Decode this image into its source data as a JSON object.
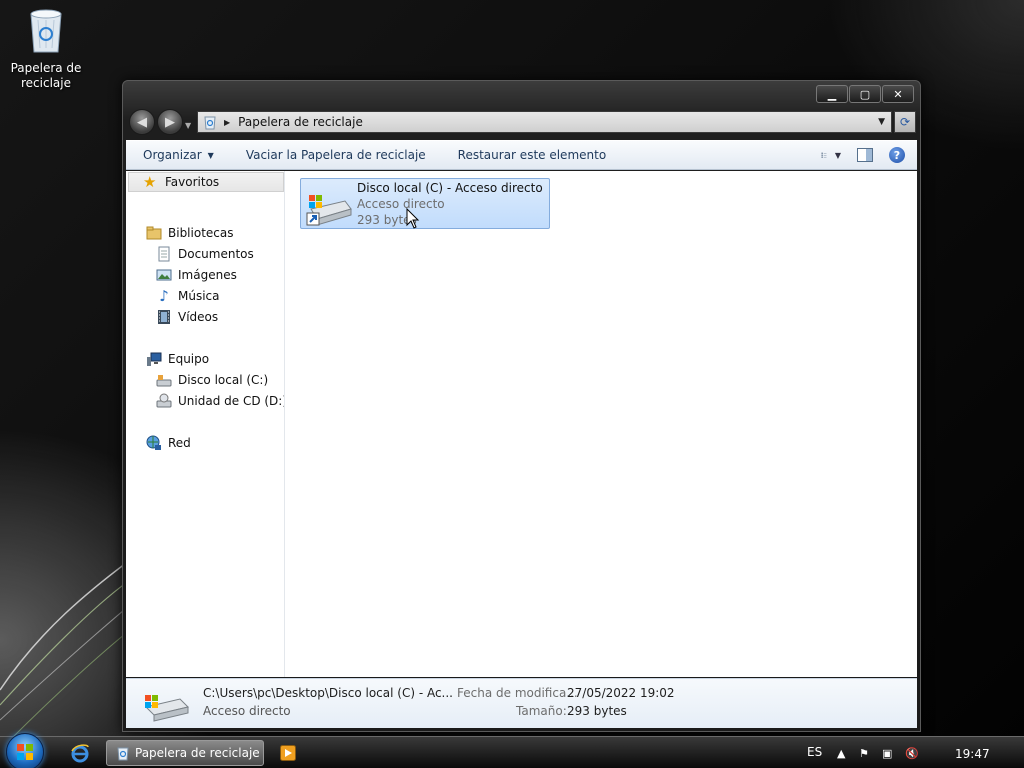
{
  "desktop": {
    "recycle_bin_label": "Papelera de reciclaje"
  },
  "window": {
    "controls": {
      "minimize": "minimize-icon",
      "maximize": "maximize-icon",
      "close": "close-icon"
    },
    "address": {
      "path": "Papelera de reciclaje"
    },
    "toolbar": {
      "organize": "Organizar",
      "empty_bin": "Vaciar la Papelera de reciclaje",
      "restore": "Restaurar este elemento"
    },
    "nav_pane": {
      "favorites": "Favoritos",
      "libraries": "Bibliotecas",
      "library_items": [
        "Documentos",
        "Imágenes",
        "Música",
        "Vídeos"
      ],
      "computer": "Equipo",
      "computer_items": [
        "Disco local (C:)",
        "Unidad de CD (D:) P"
      ],
      "network": "Red"
    },
    "items": [
      {
        "name": "Disco local (C) - Acceso directo",
        "type": "Acceso directo",
        "size": "293 bytes"
      }
    ],
    "details": {
      "path": "C:\\Users\\pc\\Desktop\\Disco local (C) - Ac...",
      "type": "Acceso directo",
      "date_label": "Fecha de modifica...",
      "date_value": "27/05/2022 19:02",
      "size_label": "Tamaño:",
      "size_value": "293 bytes"
    }
  },
  "taskbar": {
    "active_task": "Papelera de reciclaje",
    "language": "ES",
    "clock": "19:47"
  },
  "colors": {
    "toolbar_text": "#1e395b",
    "selection_bg": "#c1dcfc",
    "selection_border": "#84acdd"
  }
}
